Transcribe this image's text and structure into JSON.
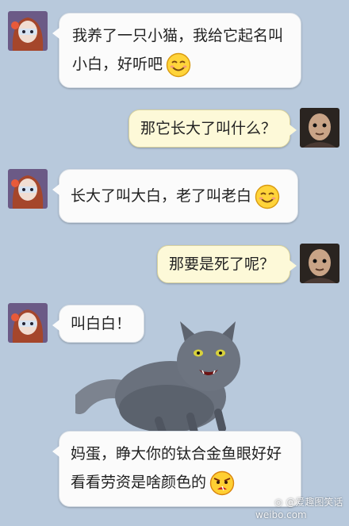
{
  "messages": [
    {
      "side": "left",
      "lines": [
        "我养了一只小猫，我给它起名叫",
        "小白，好听吧"
      ],
      "emoji": "smile-emoji"
    },
    {
      "side": "right",
      "lines": [
        "那它长大了叫什么？"
      ]
    },
    {
      "side": "left",
      "lines": [
        "长大了叫大白，老了叫老白"
      ],
      "emoji": "smile-emoji"
    },
    {
      "side": "right",
      "lines": [
        "那要是死了呢？"
      ]
    },
    {
      "side": "left",
      "lines": [
        "叫白白！"
      ]
    },
    {
      "side": "left",
      "lines": [
        "妈蛋，睁大你的钛合金鱼眼好好",
        "看看劳资是啥颜色的"
      ],
      "emoji": "angry-emoji"
    }
  ],
  "watermark": {
    "weibo_handle": "@爱趣图笑话",
    "site": "weibo.com"
  },
  "colors": {
    "background": "#b8c9dc",
    "incoming_bubble": "#fbfbfb",
    "outgoing_bubble": "#fdf9d8"
  }
}
